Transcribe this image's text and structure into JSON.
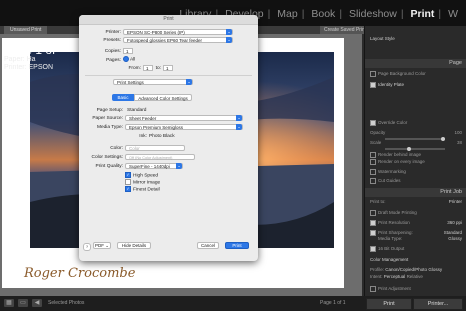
{
  "topbar": {
    "modules": [
      "Library",
      "Develop",
      "Map",
      "Book",
      "Slideshow",
      "Print",
      "W"
    ],
    "active_module": "Print"
  },
  "tabstrip": {
    "left_tab": "Unsaved Print",
    "right_tab": "Create Saved Print"
  },
  "canvas": {
    "page_label": "Page 1 of",
    "paper_line": "Paper: Ha",
    "printer_line": "Printer: EPSON",
    "signature": "Roger Crocombe"
  },
  "dialog": {
    "title": "Print",
    "printer_label": "Printer:",
    "printer_value": "EPSON SC-P800 Series (IP)",
    "presets_label": "Presets:",
    "presets_value": "Fotospeed glossies EP60 Tear feeder",
    "copies_label": "Copies:",
    "copies_value": "1",
    "pages_label": "Pages:",
    "pages_all": "All",
    "pages_from_label": "From:",
    "pages_from": "1",
    "pages_to_label": "to:",
    "pages_to": "1",
    "section_popup": "Print Settings",
    "tab_basic": "Basic",
    "tab_advanced": "Advanced Color Settings",
    "page_setup_label": "Page Setup:",
    "page_setup_value": "Standard",
    "paper_source_label": "Paper Source:",
    "paper_source_value": "Sheet Feeder",
    "media_type_label": "Media Type:",
    "media_type_value": "Epson Premium Semigloss",
    "ink_label": "Ink:",
    "ink_value": "Photo Black",
    "color_label": "Color:",
    "color_value": "Color",
    "color_settings_label": "Color Settings:",
    "color_settings_value": "Off (No Color Adjustment)",
    "print_quality_label": "Print Quality:",
    "print_quality_value": "SuperFine - 1440dpi",
    "high_speed": "High Speed",
    "mirror_image": "Mirror Image",
    "finest_detail": "Finest Detail",
    "help": "?",
    "pdf_button": "PDF",
    "hide_details": "Hide Details",
    "cancel": "Cancel",
    "print": "Print"
  },
  "right_panel": {
    "layout_row": "Layout Style",
    "header_page": "Page",
    "page_background_color": "Page Background Color",
    "identity_plate": "Identity Plate",
    "override_color": "Override Color",
    "opacity_label": "Opacity",
    "opacity_value": "100",
    "scale_label": "Scale",
    "scale_value": "38",
    "render_behind": "Render behind image",
    "render_every": "Render on every image",
    "watermarking": "Watermarking",
    "cut_guides": "Cut Guides",
    "header_print_job": "Print Job",
    "print_to_label": "Print to:",
    "print_to_value": "Printer",
    "draft_mode": "Draft Mode Printing",
    "print_resolution_label": "Print Resolution",
    "print_resolution_value": "360 ppi",
    "print_sharpening_label": "Print Sharpening:",
    "print_sharpening_value": "Standard",
    "media_type_label": "Media Type:",
    "media_type_value": "Glossy",
    "bit_output": "16 Bit Output",
    "color_management": "Color Management",
    "profile_label": "Profile:",
    "profile_value": "Canon/Copied/Photo Glossy",
    "intent_label": "Intent:",
    "intent_perceptual": "Perceptual",
    "intent_relative": "Relative",
    "print_adjustment": "Print Adjustment",
    "print_button": "Print",
    "printer_button": "Printer..."
  },
  "bottombar": {
    "selected_text": "Selected Photos",
    "page_counter": "Page 1 of 1"
  },
  "colors": {
    "accent": "#2d77e6",
    "background": "#2b2b2b"
  }
}
